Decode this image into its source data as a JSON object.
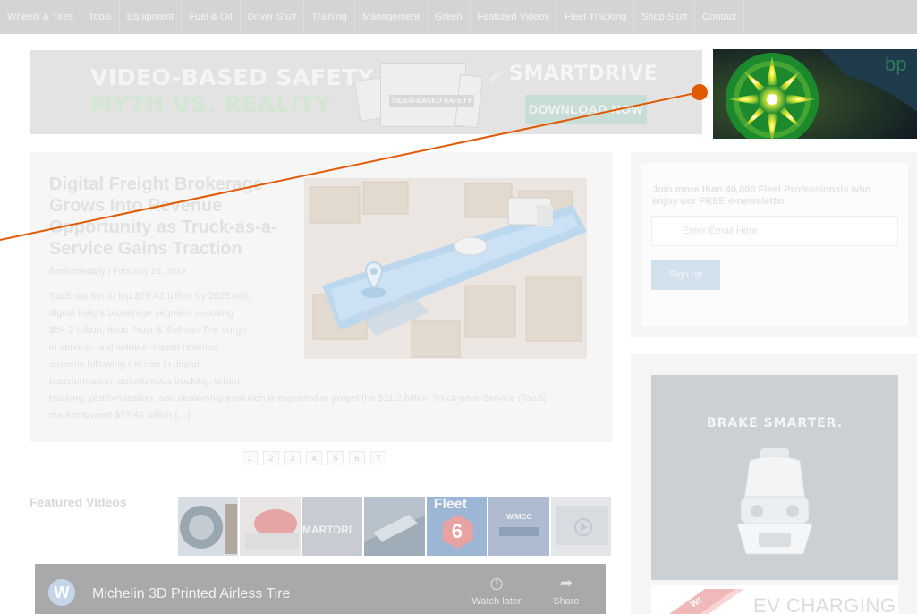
{
  "nav": {
    "items": [
      "Wheels & Tires",
      "Tools",
      "Equipment",
      "Fuel & Oil",
      "Driver Stuff",
      "Training",
      "Management",
      "Green",
      "Featured Videos",
      "Fleet Tracking",
      "Shop Stuff",
      "Contact"
    ]
  },
  "banner": {
    "line1": "VIDEO-BASED SAFETY",
    "line2": "MYTH VS. REALITY",
    "doc_title": "VIDEO-BASED SAFETY",
    "brand": "SMARTDRIVE",
    "cta": "DOWNLOAD NOW"
  },
  "bp_image": {
    "logo_text": "bp"
  },
  "article": {
    "title": "Digital Freight Brokerage Grows Into Revenue Opportunity as Truck-as-a-Service Gains Traction",
    "source": "fleetnewsdaily",
    "date": "February 28, 2019",
    "excerpt_lines": [
      "TaaS market to top $79.42 billion by 2025 with",
      "digital freight brokerage segment reaching",
      "$54.2 billion, finds Frost & Sullivan The surge",
      "in service- and solution-based revenue",
      "streams following the rise in digital",
      "transformation, autonomous trucking, urban",
      "trucking, platformization, and dealership evolution is expected to propel the $11.2 billion Truck-as-a-Service (TaaS)",
      "market toward $79.42 billion […]"
    ]
  },
  "pagination": {
    "pages": [
      "1",
      "2",
      "3",
      "4",
      "5",
      "6",
      "7"
    ]
  },
  "featured_videos": {
    "label": "Featured Videos",
    "thumb_texts": {
      "t3": "MARTDRI",
      "t5a": "Fleet",
      "t5b": "6",
      "t6": "WIMCO"
    },
    "player": {
      "logo_letter": "W",
      "title": "Michelin 3D Printed Airless Tire",
      "watch_later": "Watch later",
      "share": "Share"
    }
  },
  "newsletter": {
    "heading": "Join more than 40,000 Fleet Professionals who enjoy our FREE e-newsletter",
    "email_placeholder": "Enter Email Here",
    "signup_label": "Sign up"
  },
  "sidebar_ad": {
    "headline": "BRAKE SMARTER.",
    "ev_text": "EV CHARGING",
    "new_badge": "W!"
  },
  "colors": {
    "annotation_line": "#e05a00",
    "nav_bg": "#d4d4d4"
  }
}
